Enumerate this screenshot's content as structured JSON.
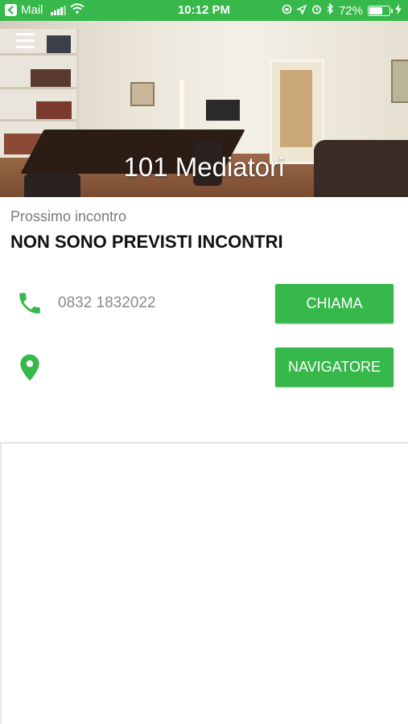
{
  "status_bar": {
    "back_app": "Mail",
    "time": "10:12 PM",
    "battery_percent": "72%",
    "battery_level": 0.72
  },
  "header": {
    "title": "101 Mediatori",
    "menu_icon": "hamburger-icon"
  },
  "next_meeting": {
    "label": "Prossimo incontro",
    "value": "NON SONO PREVISTI INCONTRI"
  },
  "contact": {
    "phone": "0832 1832022",
    "call_button": "CHIAMA",
    "navigate_button": "NAVIGATORE",
    "phone_icon": "phone-icon",
    "location_icon": "location-pin-icon"
  },
  "colors": {
    "accent": "#36b84a"
  }
}
